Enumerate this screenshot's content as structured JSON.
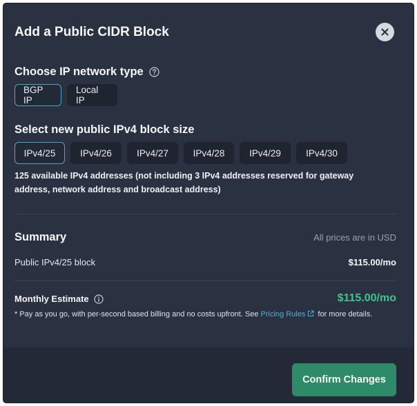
{
  "dialog": {
    "title": "Add a Public CIDR Block"
  },
  "network_type": {
    "heading": "Choose IP network type",
    "options": [
      "BGP IP",
      "Local IP"
    ],
    "selected": "BGP IP"
  },
  "block_size": {
    "heading": "Select new public IPv4 block size",
    "options": [
      "IPv4/25",
      "IPv4/26",
      "IPv4/27",
      "IPv4/28",
      "IPv4/29",
      "IPv4/30"
    ],
    "selected": "IPv4/25",
    "note": "125 available IPv4 addresses (not including 3 IPv4 addresses reserved for gateway address, network address and broadcast address)"
  },
  "summary": {
    "heading": "Summary",
    "currency_note": "All prices are in USD",
    "line_item_label": "Public IPv4/25 block",
    "line_item_price": "$115.00/mo",
    "estimate_label": "Monthly Estimate",
    "estimate_price": "$115.00/mo",
    "fine_print_before": "* Pay as you go, with per-second based billing and no costs upfront. See",
    "fine_print_link": "Pricing Rules",
    "fine_print_after": "for more details."
  },
  "footer": {
    "confirm_label": "Confirm Changes"
  },
  "colors": {
    "background": "#2a3140",
    "accent_border": "#4aa9c4",
    "price_green": "#3fc48e",
    "confirm_button": "#2e8a68",
    "link": "#4db3d6"
  }
}
